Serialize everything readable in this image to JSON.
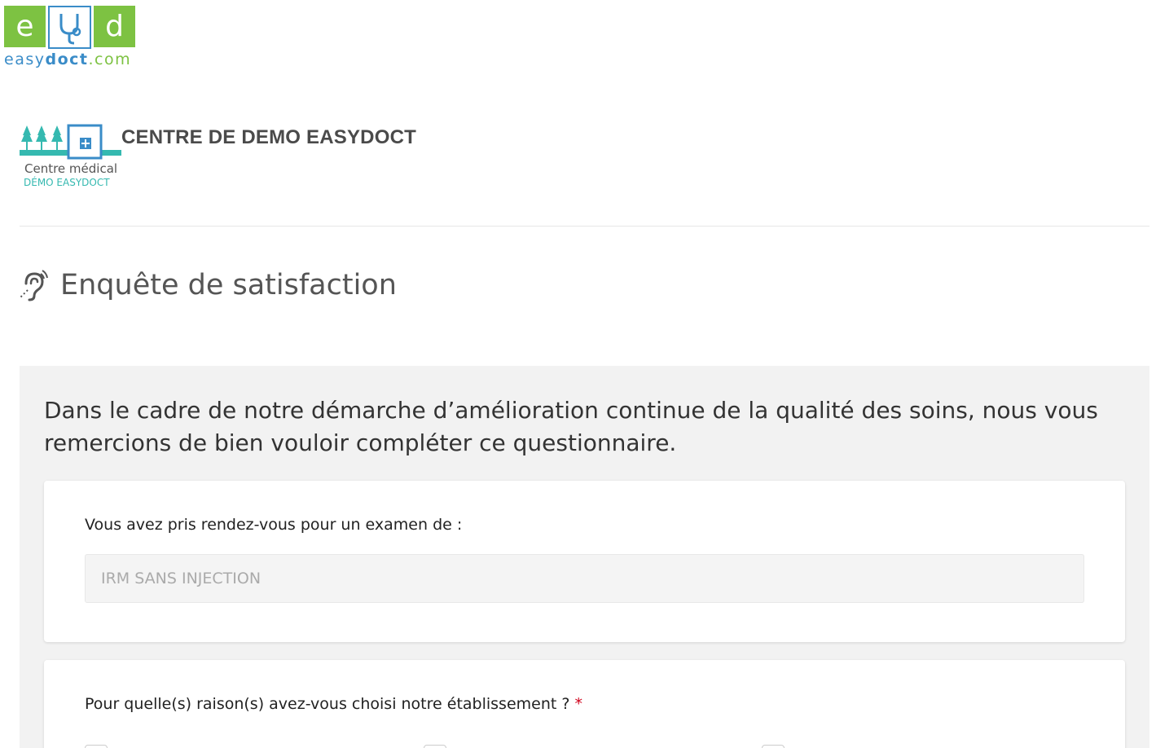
{
  "brand": {
    "tiles": [
      "e",
      "",
      "d"
    ],
    "word_part1": "easy",
    "word_part2": "doct",
    "word_part3": ".com"
  },
  "center": {
    "name": "CENTRE DE DEMO EASYDOCT",
    "logo_line1": "Centre médical",
    "logo_line2": "DÉMO EASYDOCT"
  },
  "survey": {
    "title": "Enquête de satisfaction",
    "intro": "Dans le cadre de notre démarche d’amélioration continue de la qualité des soins, nous vous remercions de bien vouloir compléter ce questionnaire.",
    "q1": {
      "label": "Vous avez pris rendez-vous pour un examen de :",
      "value": "IRM SANS INJECTION"
    },
    "q2": {
      "label": "Pour quelle(s) raison(s) avez-vous choisi notre établissement ?",
      "required_mark": "*"
    }
  },
  "icons": {
    "hearing": "hearing-icon",
    "stethoscope": "stethoscope-icon",
    "medical_cross": "medical-cross-icon",
    "trees": "tree-icon"
  },
  "colors": {
    "brand_green": "#7dc242",
    "brand_blue": "#3a8cc8",
    "teal": "#35b9b0",
    "required": "#d0021b"
  }
}
